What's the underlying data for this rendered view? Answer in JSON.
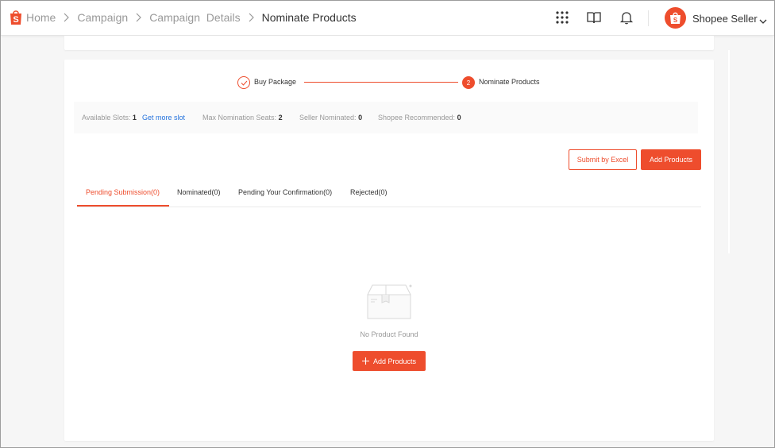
{
  "header": {
    "breadcrumb": [
      "Home",
      "Campaign",
      "Campaign",
      "Details",
      "Nominate Products"
    ],
    "seller_name": "Shopee Seller",
    "brand_color": "#ee4d2d",
    "icons": [
      "apps-grid-icon",
      "book-icon",
      "bell-icon",
      "avatar",
      "chevron-down-icon"
    ]
  },
  "stepper": {
    "steps": [
      {
        "label": "Buy Package",
        "state": "done"
      },
      {
        "label": "Nominate Products",
        "state": "active",
        "number": "2"
      }
    ]
  },
  "slots": {
    "available_label": "Available Slots:",
    "available_value": "1",
    "get_more": "Get more slot",
    "max_label": "Max Nomination Seats:",
    "max_value": "2",
    "seller_label": "Seller Nominated:",
    "seller_value": "0",
    "shopee_label": "Shopee Recommended:",
    "shopee_value": "0"
  },
  "actions": {
    "submit_excel": "Submit by Excel",
    "add_products": "Add Products"
  },
  "tabs": [
    {
      "label": "Pending Submission(0)",
      "active": true
    },
    {
      "label": "Nominated(0)",
      "active": false
    },
    {
      "label": "Pending Your Confirmation(0)",
      "active": false
    },
    {
      "label": "Rejected(0)",
      "active": false
    }
  ],
  "empty": {
    "text": "No Product Found",
    "button": "Add Products"
  }
}
